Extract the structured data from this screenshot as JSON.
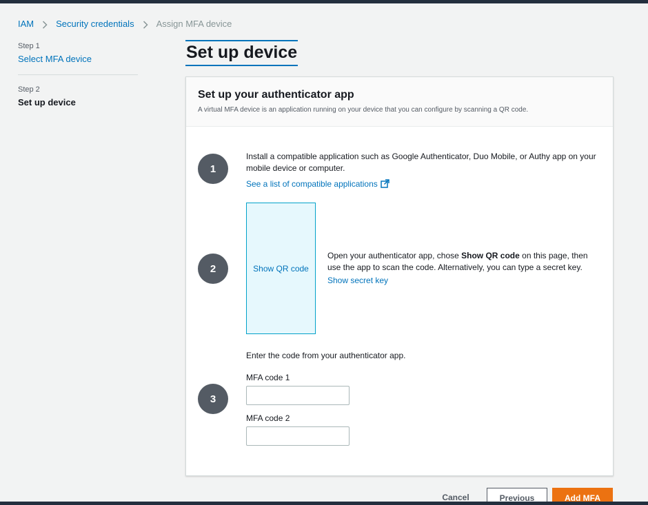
{
  "breadcrumb": {
    "items": [
      "IAM",
      "Security credentials",
      "Assign MFA device"
    ]
  },
  "steps": [
    {
      "label": "Step 1",
      "title": "Select MFA device"
    },
    {
      "label": "Step 2",
      "title": "Set up device"
    }
  ],
  "page": {
    "title": "Set up device"
  },
  "container": {
    "title": "Set up your authenticator app",
    "description": "A virtual MFA device is an application running on your device that you can configure by scanning a QR code."
  },
  "step_one": {
    "number": "1",
    "text": "Install a compatible application such as Google Authenticator, Duo Mobile, or Authy app on your mobile device or computer.",
    "link": "See a list of compatible applications"
  },
  "step_two": {
    "number": "2",
    "qr_label": "Show QR code",
    "text_before": "Open your authenticator app, chose ",
    "text_bold": "Show QR code",
    "text_after": " on this page, then use the app to scan the code. Alternatively, you can type a secret key.",
    "link": "Show secret key"
  },
  "step_three": {
    "number": "3",
    "instruction": "Enter the code from your authenticator app.",
    "code1_label": "MFA code 1",
    "code1_value": "",
    "code2_label": "MFA code 2",
    "code2_value": ""
  },
  "footer": {
    "cancel": "Cancel",
    "previous": "Previous",
    "add": "Add MFA"
  },
  "colors": {
    "link": "#0073bb",
    "primary_button": "#ec7211",
    "step_circle": "#545b64",
    "qr_background": "#e6f8fd"
  }
}
